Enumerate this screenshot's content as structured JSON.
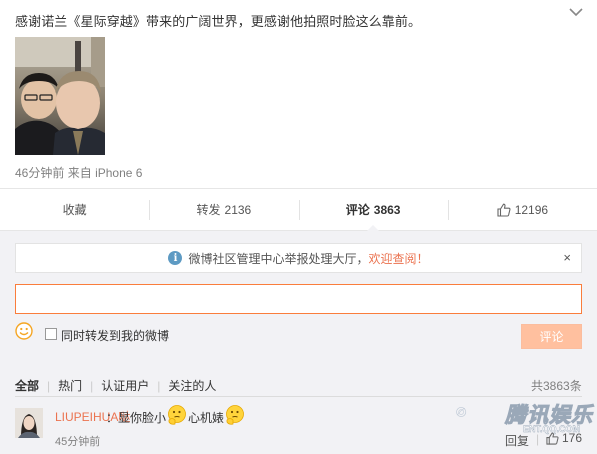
{
  "post": {
    "text": "感谢诺兰《星际穿越》带来的广阔世界，更感谢他拍照时脸这么靠前。",
    "time": "46分钟前",
    "source_prefix": "来自",
    "source": "iPhone 6"
  },
  "actions": {
    "favorite": "收藏",
    "repost_label": "转发",
    "repost_count": "2136",
    "comment_label": "评论",
    "comment_count": "3863",
    "like_count": "12196"
  },
  "notice": {
    "text": "微博社区管理中心举报处理大厅，",
    "link": "欢迎查阅！",
    "close": "×"
  },
  "composer": {
    "input_value": "",
    "forward_label": "同时转发到我的微博",
    "submit": "评论"
  },
  "tabs": [
    "全部",
    "热门",
    "认证用户",
    "关注的人"
  ],
  "comment_total": "共3863条",
  "comments": [
    {
      "author": "LIUPEIHUA哒",
      "text_before": "：显你脸小",
      "text_after": "心机婊",
      "time": "45分钟前",
      "reply": "回复",
      "likes": "176"
    }
  ],
  "watermark": {
    "text": "腾讯娱乐",
    "sub": "ENT.QQ.COM"
  },
  "colors": {
    "accent": "#eb7350",
    "input_border": "#fa7d3c",
    "submit_disabled": "#ffc09f",
    "comment_bg": "#f2f2f5",
    "info_icon": "#5d9ac3"
  },
  "icons": {
    "chevron": "chevron-down-icon",
    "like": "thumbs-up-icon",
    "info": "info-icon",
    "close": "close-icon",
    "emoji": "smiley-icon",
    "comment_emoji": "thinking-face-icon"
  }
}
